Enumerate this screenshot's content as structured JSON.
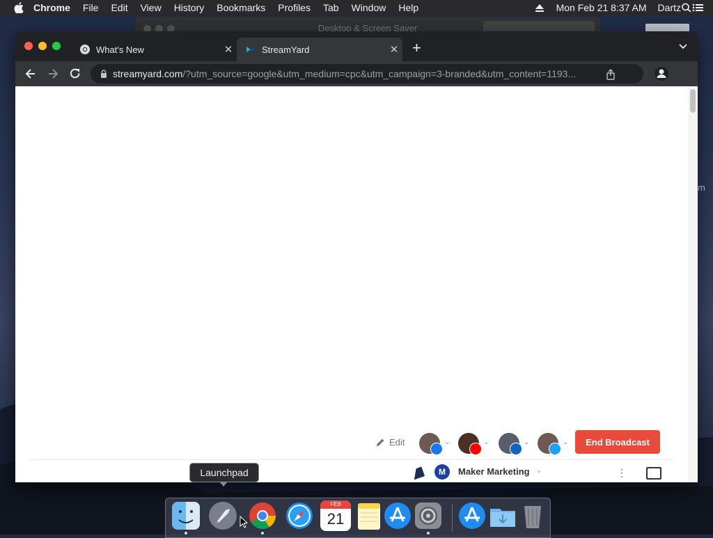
{
  "menubar": {
    "app_name": "Chrome",
    "items": [
      "File",
      "Edit",
      "View",
      "History",
      "Bookmarks",
      "Profiles",
      "Tab",
      "Window",
      "Help"
    ],
    "datetime": "Mon Feb 21  8:37 AM",
    "user": "Dartz"
  },
  "background_window": {
    "title": "Desktop & Screen Saver",
    "side_text": "m"
  },
  "browser": {
    "tabs": [
      {
        "title": "What's New",
        "active": false
      },
      {
        "title": "StreamYard",
        "active": true
      }
    ],
    "url_host": "streamyard.com",
    "url_path": "/?utm_source=google&utm_medium=cpc&utm_campaign=3-branded&utm_content=1193..."
  },
  "streamyard": {
    "edit_label": "Edit",
    "end_broadcast_label": "End Broadcast",
    "destinations": [
      {
        "platform": "facebook",
        "color": "#1877f2"
      },
      {
        "platform": "youtube",
        "color": "#ff0000"
      },
      {
        "platform": "linkedin",
        "color": "#0a66c2"
      },
      {
        "platform": "twitter",
        "color": "#1da1f2"
      }
    ],
    "account_initial": "M",
    "account_name": "Maker Marketing"
  },
  "dock": {
    "tooltip": "Launchpad",
    "apps": [
      "finder",
      "launchpad",
      "chrome",
      "safari",
      "calendar",
      "notes",
      "app-store",
      "system-preferences",
      "app-store-downloads",
      "downloads-folder",
      "trash"
    ],
    "calendar_month": "FEB",
    "calendar_day": "21"
  },
  "colors": {
    "end_broadcast": "#e84a3b",
    "account_badge": "#1f3f9e"
  }
}
